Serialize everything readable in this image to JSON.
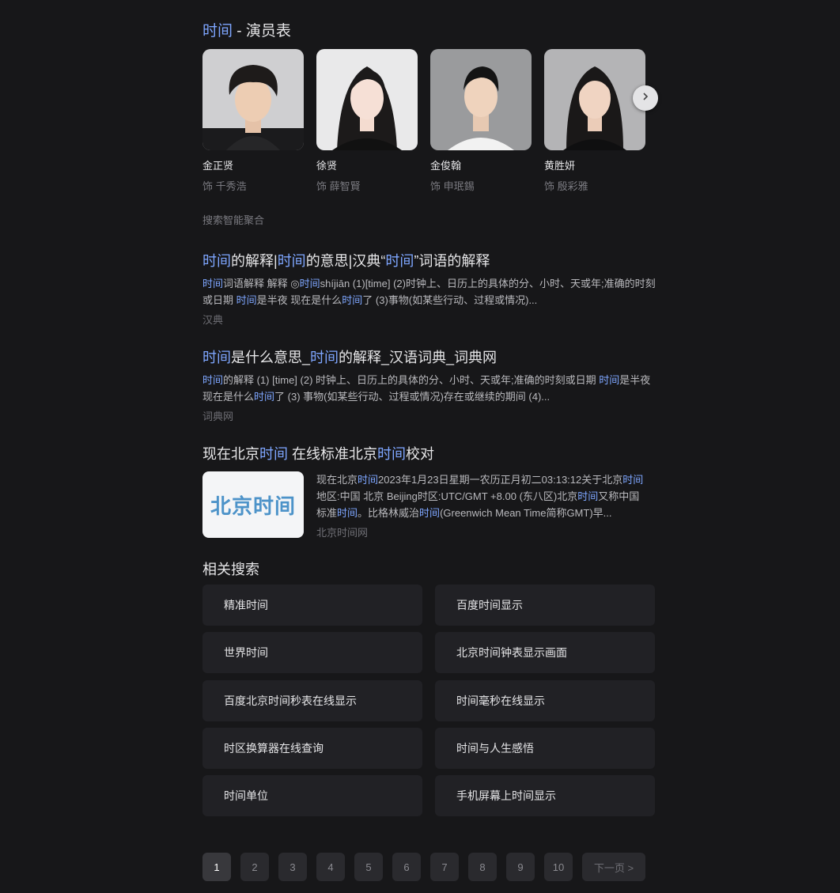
{
  "cast": {
    "title_keyword": "时间",
    "title_rest": " - 演员表",
    "actors": [
      {
        "name": "金正贤",
        "role": "饰 千秀浩"
      },
      {
        "name": "徐贤",
        "role": "饰 薛智賢"
      },
      {
        "name": "金俊翰",
        "role": "饰 申珉錫"
      },
      {
        "name": "黄胜妍",
        "role": "饰 殷彩雅"
      }
    ]
  },
  "aggregate_label": "搜索智能聚合",
  "results": [
    {
      "title_parts": [
        {
          "t": "时间",
          "hl": true
        },
        {
          "t": "的解释|",
          "hl": false
        },
        {
          "t": "时间",
          "hl": true
        },
        {
          "t": "的意思|汉典“",
          "hl": false
        },
        {
          "t": "时间",
          "hl": true
        },
        {
          "t": "”词语的解释",
          "hl": false
        }
      ],
      "snippet_parts": [
        {
          "t": "时间",
          "hl": true
        },
        {
          "t": "词语解释 解释 ◎",
          "hl": false
        },
        {
          "t": "时间",
          "hl": true
        },
        {
          "t": "shíjiān (1)[time] (2)时钟上、日历上的具体的分、小时、天或年;准确的时刻或日期 ",
          "hl": false
        },
        {
          "t": "时间",
          "hl": true
        },
        {
          "t": "是半夜 现在是什么",
          "hl": false
        },
        {
          "t": "时间",
          "hl": true
        },
        {
          "t": "了 (3)事物(如某些行动、过程或情况)...",
          "hl": false
        }
      ],
      "source": "汉典"
    },
    {
      "title_parts": [
        {
          "t": "时间",
          "hl": true
        },
        {
          "t": "是什么意思_",
          "hl": false
        },
        {
          "t": "时间",
          "hl": true
        },
        {
          "t": "的解释_汉语词典_词典网",
          "hl": false
        }
      ],
      "snippet_parts": [
        {
          "t": "时间",
          "hl": true
        },
        {
          "t": "的解释 (1) [time] (2) 时钟上、日历上的具体的分、小时、天或年;准确的时刻或日期 ",
          "hl": false
        },
        {
          "t": "时间",
          "hl": true
        },
        {
          "t": "是半夜 现在是什么",
          "hl": false
        },
        {
          "t": "时间",
          "hl": true
        },
        {
          "t": "了 (3) 事物(如某些行动、过程或情况)存在或继续的期间 (4)...",
          "hl": false
        }
      ],
      "source": "词典网"
    },
    {
      "title_parts": [
        {
          "t": "现在北京",
          "hl": false
        },
        {
          "t": "时间",
          "hl": true
        },
        {
          "t": " 在线标准北京",
          "hl": false
        },
        {
          "t": "时间",
          "hl": true
        },
        {
          "t": "校对",
          "hl": false
        }
      ],
      "thumb_text": "北京时间",
      "snippet_parts": [
        {
          "t": "现在北京",
          "hl": false
        },
        {
          "t": "时间",
          "hl": true
        },
        {
          "t": "2023年1月23日星期一农历正月初二03:13:12关于北京",
          "hl": false
        },
        {
          "t": "时间",
          "hl": true
        },
        {
          "t": "地区:中国 北京 Beijing时区:UTC/GMT +8.00 (东八区)北京",
          "hl": false
        },
        {
          "t": "时间",
          "hl": true
        },
        {
          "t": "又称中国标准",
          "hl": false
        },
        {
          "t": "时间",
          "hl": true
        },
        {
          "t": "。比格林威治",
          "hl": false
        },
        {
          "t": "时间",
          "hl": true
        },
        {
          "t": "(Greenwich Mean Time简称GMT)早...",
          "hl": false
        }
      ],
      "source": "北京时间网"
    }
  ],
  "related": {
    "title": "相关搜索",
    "items": [
      "精准时间",
      "百度时间显示",
      "世界时间",
      "北京时间钟表显示画面",
      "百度北京时间秒表在线显示",
      "时间毫秒在线显示",
      "时区换算器在线查询",
      "时间与人生感悟",
      "时间单位",
      "手机屏幕上时间显示"
    ]
  },
  "pagination": {
    "pages": [
      "1",
      "2",
      "3",
      "4",
      "5",
      "6",
      "7",
      "8",
      "9",
      "10"
    ],
    "current": "1",
    "next_label": "下一页 >"
  },
  "colors": {
    "background": "#171719",
    "highlight": "#7ea6ff",
    "card": "#212125"
  },
  "icons": {
    "next_arrow": "chevron-right-icon"
  }
}
